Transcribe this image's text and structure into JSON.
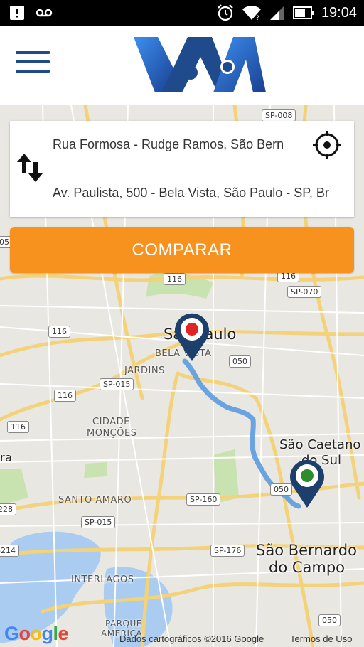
{
  "status_bar": {
    "time": "19:04",
    "icons": [
      "alert-icon",
      "voicemail-icon",
      "alarm-icon",
      "wifi-icon",
      "cell-signal-icon",
      "battery-icon"
    ]
  },
  "header": {
    "menu_icon": "hamburger-menu-icon",
    "logo": "YAM logo",
    "brand_colors": {
      "primary": "#1f4a8c",
      "accent": "#2a6fd6"
    }
  },
  "route": {
    "origin_value": "Rua Formosa - Rudge Ramos, São Bern",
    "destination_value": "Av. Paulista, 500 - Bela Vista, São Paulo - SP, Br",
    "swap_icon": "swap-vertical-icon",
    "locate_icon": "crosshair-locate-icon"
  },
  "compare_button": {
    "label": "COMPARAR",
    "color": "#f7921e"
  },
  "map": {
    "route_color": "#5b9be0",
    "cities": [
      {
        "name": "São Paulo"
      },
      {
        "name": "São Bernardo",
        "line2": "do Campo"
      },
      {
        "name": "São Caetano",
        "line2": "do Sul"
      }
    ],
    "neighborhoods": [
      "BELA VISTA",
      "JARDINS",
      "CIDADE",
      "MONÇÕES",
      "SANTO AMARO",
      "INTERLAGOS",
      "PARQUE",
      "AMERICA",
      "ra"
    ],
    "road_shields": [
      "SP-008",
      "SP-070",
      "116",
      "116",
      "116",
      "116",
      "SP-015",
      "SP-015",
      "050",
      "050",
      "050",
      "SP-160",
      "SP-176",
      "05",
      "228",
      "-214",
      "116"
    ],
    "pins": [
      {
        "name": "destination-pin",
        "color": "#e02424"
      },
      {
        "name": "origin-pin",
        "color": "#2e8b2e"
      }
    ],
    "attribution": "Dados cartográficos ©2016 Google",
    "terms": "Termos de Uso",
    "google": [
      "G",
      "o",
      "o",
      "g",
      "l",
      "e"
    ]
  }
}
